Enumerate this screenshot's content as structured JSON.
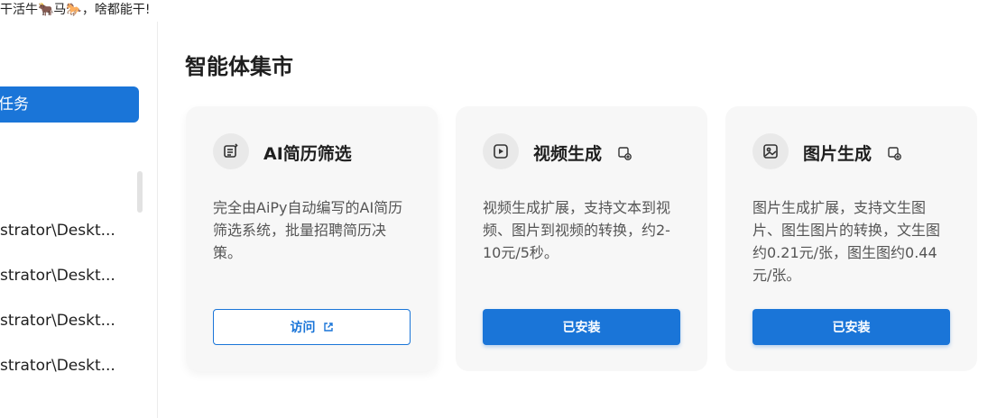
{
  "header": {
    "slogan": "干活牛🐂马🐎，啥都能干!"
  },
  "sidebar": {
    "active_task_label": "任务",
    "task_items": [
      "strator\\Deskt...",
      "strator\\Deskt...",
      "strator\\Deskt...",
      "strator\\Deskt..."
    ]
  },
  "main": {
    "title": "智能体集市",
    "cards": [
      {
        "title": "AI简历筛选",
        "description": "完全由AiPy自动编写的AI简历筛选系统，批量招聘简历决策。",
        "button_label": "访问",
        "icon": "resume-filter-icon"
      },
      {
        "title": "视频生成",
        "description": "视频生成扩展，支持文本到视频、图片到视频的转换，约2-10元/5秒。",
        "button_label": "已安装",
        "icon": "video-icon"
      },
      {
        "title": "图片生成",
        "description": "图片生成扩展，支持文生图片、图生图片的转换，文生图约0.21元/张，图生图约0.44元/张。",
        "button_label": "已安装",
        "icon": "image-icon"
      }
    ]
  },
  "colors": {
    "accent": "#1a75d8",
    "card_bg": "#f7f7f7",
    "text": "#1f1f1f",
    "muted": "#555555"
  }
}
